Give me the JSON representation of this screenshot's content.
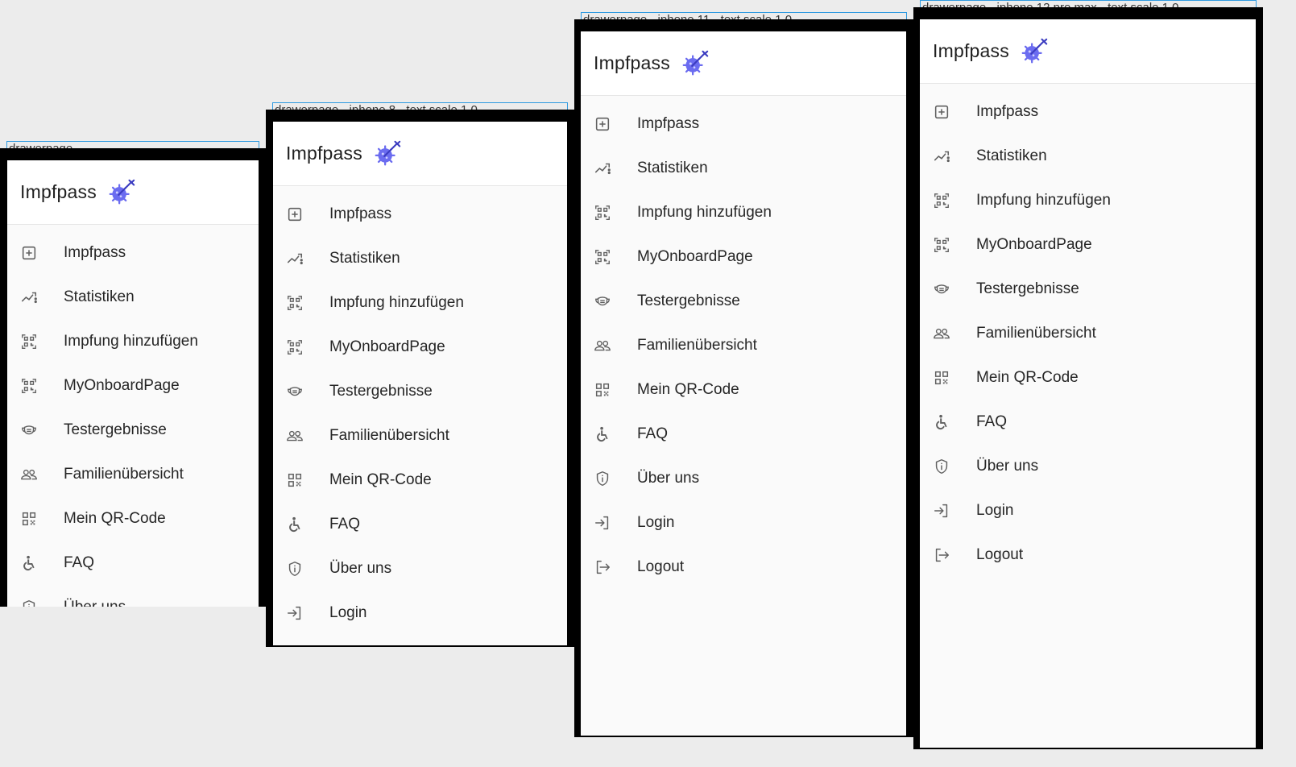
{
  "golden_labels": [
    "drawerpage",
    "drawerpage - iphone 8 - text scale 1.0",
    "drawerpage - iphone 11 - text scale 1.0",
    "drawerpage - iphone 12 pro max - text scale 1.0"
  ],
  "drawer": {
    "app_title": "Impfpass",
    "logo_icon": "virus-syringe-logo",
    "brand_color": "#6b6cf0",
    "items": [
      {
        "label": "Impfpass",
        "icon": "plus-box-icon"
      },
      {
        "label": "Statistiken",
        "icon": "trending-chart-icon"
      },
      {
        "label": "Impfung hinzufügen",
        "icon": "qr-scan-icon"
      },
      {
        "label": "MyOnboardPage",
        "icon": "qr-scan-icon"
      },
      {
        "label": "Testergebnisse",
        "icon": "mask-icon"
      },
      {
        "label": "Familienübersicht",
        "icon": "people-icon"
      },
      {
        "label": "Mein QR-Code",
        "icon": "qr-code-icon"
      },
      {
        "label": "FAQ",
        "icon": "accessible-icon"
      },
      {
        "label": "Über uns",
        "icon": "shield-info-icon"
      },
      {
        "label": "Login",
        "icon": "login-icon"
      },
      {
        "label": "Logout",
        "icon": "logout-icon"
      }
    ]
  }
}
